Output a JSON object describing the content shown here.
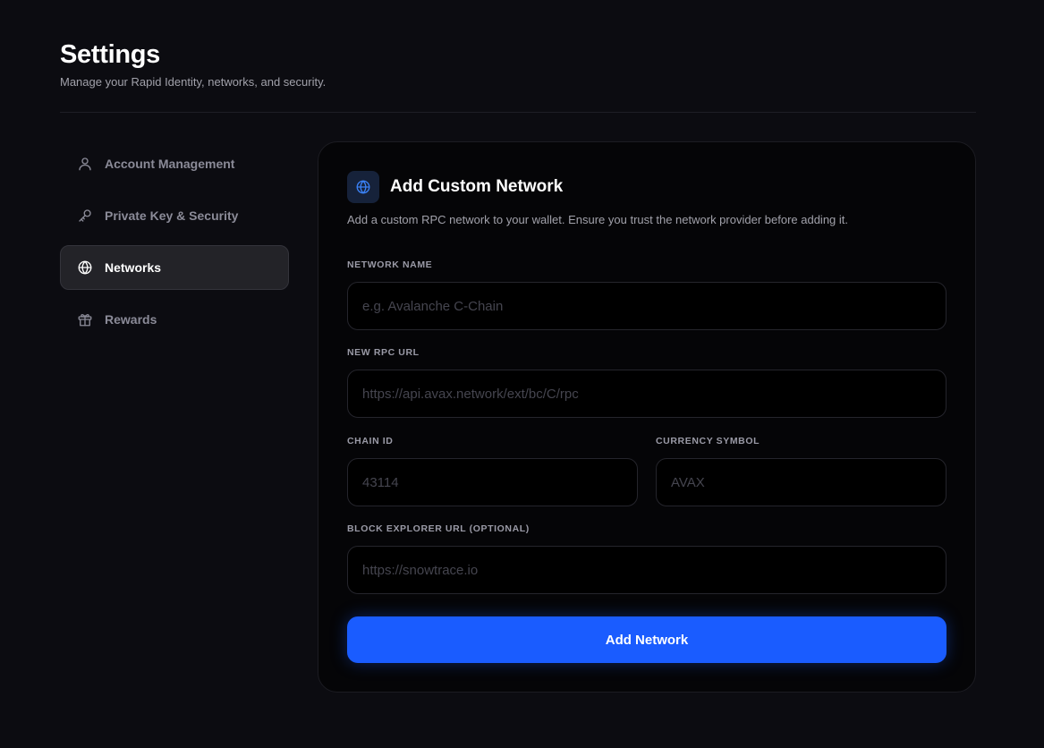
{
  "header": {
    "title": "Settings",
    "subtitle": "Manage your Rapid Identity, networks, and security."
  },
  "sidebar": {
    "items": [
      {
        "label": "Account Management",
        "icon": "user-icon",
        "active": false
      },
      {
        "label": "Private Key & Security",
        "icon": "key-icon",
        "active": false
      },
      {
        "label": "Networks",
        "icon": "globe-icon",
        "active": true
      },
      {
        "label": "Rewards",
        "icon": "gift-icon",
        "active": false
      }
    ]
  },
  "card": {
    "icon": "globe-icon",
    "title": "Add Custom Network",
    "description": "Add a custom RPC network to your wallet. Ensure you trust the network provider before adding it.",
    "fields": {
      "network_name": {
        "label": "NETWORK NAME",
        "value": "",
        "placeholder": "e.g. Avalanche C-Chain"
      },
      "rpc_url": {
        "label": "NEW RPC URL",
        "value": "",
        "placeholder": "https://api.avax.network/ext/bc/C/rpc"
      },
      "chain_id": {
        "label": "CHAIN ID",
        "value": "",
        "placeholder": "43114"
      },
      "currency_symbol": {
        "label": "CURRENCY SYMBOL",
        "value": "",
        "placeholder": "AVAX"
      },
      "explorer_url": {
        "label": "BLOCK EXPLORER URL (OPTIONAL)",
        "value": "",
        "placeholder": "https://snowtrace.io"
      }
    },
    "submit_label": "Add Network"
  },
  "colors": {
    "background": "#0c0c11",
    "card": "#050507",
    "accent": "#1a5cff",
    "active_item": "#232328",
    "icon_accent": "#3b82f6"
  }
}
